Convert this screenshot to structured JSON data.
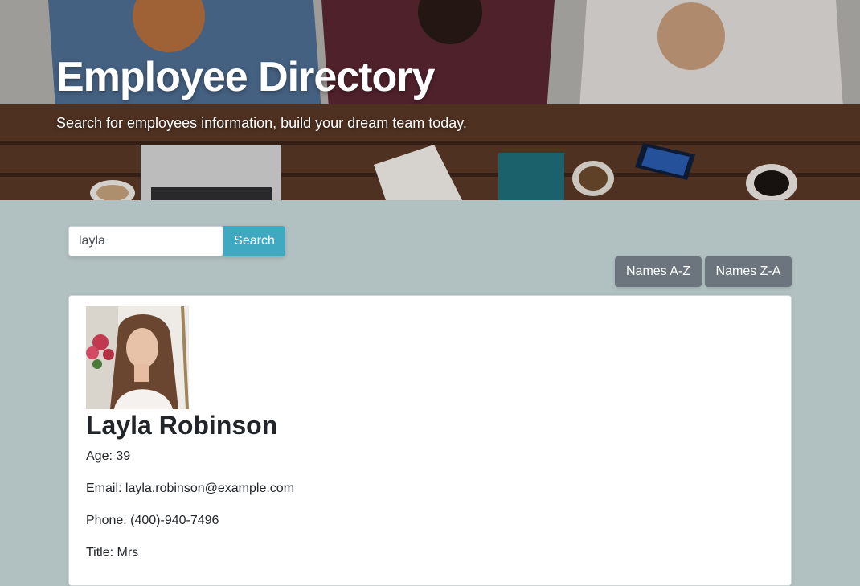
{
  "hero": {
    "title": "Employee Directory",
    "subtitle": "Search for employees information, build your dream team today."
  },
  "search": {
    "value": "layla",
    "button_label": "Search"
  },
  "sort": {
    "az_label": "Names A-Z",
    "za_label": "Names Z-A"
  },
  "employee": {
    "name": "Layla Robinson",
    "age": "Age: 39",
    "email": "Email: layla.robinson@example.com",
    "phone": "Phone: (400)-940-7496",
    "title": "Title: Mrs"
  },
  "colors": {
    "page_background": "#b1c0c0",
    "search_button": "#3fa9c1",
    "sort_button": "#6c757d"
  }
}
